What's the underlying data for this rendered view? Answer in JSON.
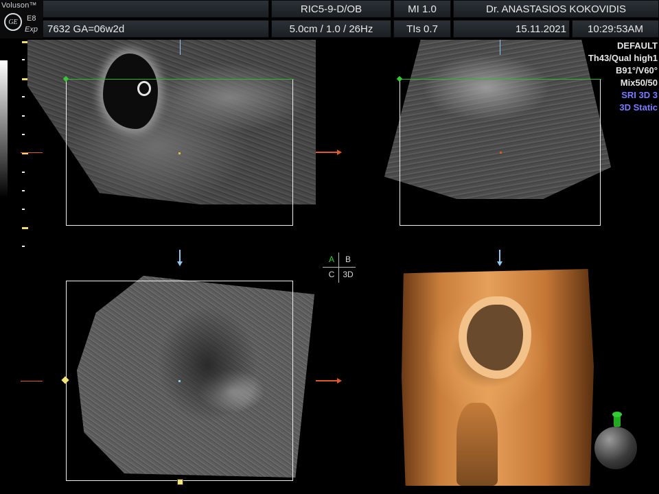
{
  "header": {
    "brand": "Voluson™",
    "model": "E8",
    "edition": "Exp",
    "logo_text": "GE",
    "patient": "7632  GA=06w2d",
    "probe": "RIC5-9-D/OB",
    "depth": "5.0cm / 1.0 / 26Hz",
    "mi": "MI  1.0",
    "tis": "TIs  0.7",
    "doctor": "Dr. ANASTASIOS KOKOVIDIS",
    "date": "15.11.2021",
    "time": "10:29:53AM"
  },
  "params": {
    "preset": "DEFAULT",
    "quality": "Th43/Qual high1",
    "angles": "B91°/V60°",
    "mix": "Mix50/50",
    "sri": "SRI 3D 3",
    "mode": "3D Static"
  },
  "quadrant": {
    "a": "A",
    "b": "B",
    "c": "C",
    "d": "3D",
    "active": "A"
  },
  "colors": {
    "accent_blue": "#7b7bff",
    "active_green": "#33cc33",
    "arrow_orange": "#e05a28",
    "arrow_blue": "#8fc9ee"
  }
}
